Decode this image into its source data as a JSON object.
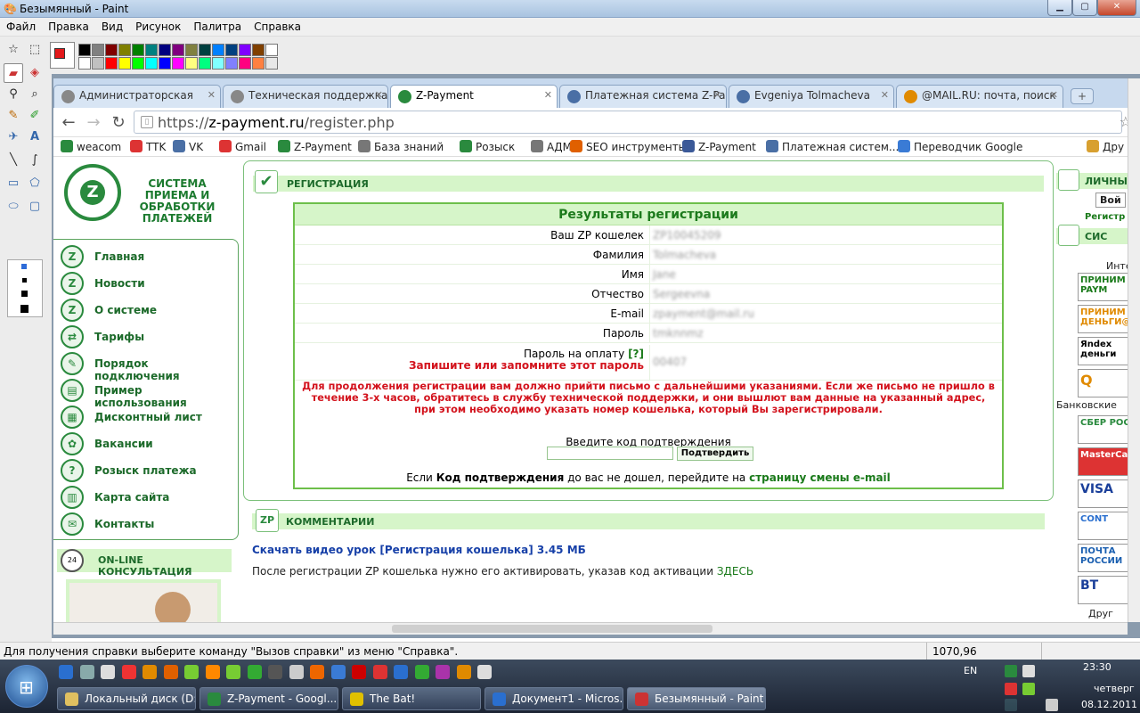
{
  "paint": {
    "title": "Безымянный - Paint",
    "menu": [
      "Файл",
      "Правка",
      "Вид",
      "Рисунок",
      "Палитра",
      "Справка"
    ],
    "status_text": "Для получения справки выберите команду \"Вызов справки\" из меню \"Справка\".",
    "coords": "1070,96",
    "palette_top": [
      "#000000",
      "#808080",
      "#800000",
      "#808000",
      "#008000",
      "#008080",
      "#000080",
      "#800080",
      "#808040",
      "#004040",
      "#0080ff",
      "#004080",
      "#8000ff",
      "#804000",
      "#ffffff"
    ],
    "palette_bottom": [
      "#ffffff",
      "#c0c0c0",
      "#ff0000",
      "#ffff00",
      "#00ff00",
      "#00ffff",
      "#0000ff",
      "#ff00ff",
      "#ffff80",
      "#00ff80",
      "#80ffff",
      "#8080ff",
      "#ff0080",
      "#ff8040",
      "#e8e8e8"
    ]
  },
  "browser": {
    "tabs": [
      {
        "label": "Администраторская",
        "icon_color": "#888888"
      },
      {
        "label": "Техническая поддержка",
        "icon_color": "#888888"
      },
      {
        "label": "Z-Payment",
        "icon_color": "#2a8a3e"
      },
      {
        "label": "Платежная система Z-Pay",
        "icon_color": "#4a6fa5"
      },
      {
        "label": "Evgeniya Tolmacheva",
        "icon_color": "#4a6fa5"
      },
      {
        "label": "@MAIL.RU: почта, поиск",
        "icon_color": "#e08a00"
      }
    ],
    "url_prefix": "https://",
    "url_domain": "z-payment.ru",
    "url_path": "/register.php",
    "bookmarks": [
      {
        "label": "weacom",
        "color": "#2a8a3e"
      },
      {
        "label": "TTK",
        "color": "#d33"
      },
      {
        "label": "VK",
        "color": "#4a6fa5"
      },
      {
        "label": "Gmail",
        "color": "#d33"
      },
      {
        "label": "Z-Payment",
        "color": "#2a8a3e"
      },
      {
        "label": "База знаний",
        "color": "#777"
      },
      {
        "label": "Розыск",
        "color": "#2a8a3e"
      },
      {
        "label": "АДМ",
        "color": "#777"
      },
      {
        "label": "SEO инструменты",
        "color": "#e06000"
      },
      {
        "label": "Z-Payment",
        "color": "#3b5998"
      },
      {
        "label": "Платежная систем...",
        "color": "#4a6fa5"
      },
      {
        "label": "Переводчик Google",
        "color": "#3a7bd5"
      },
      {
        "label": "Дру",
        "color": "#d8a030"
      }
    ]
  },
  "site": {
    "logo_text": "СИСТЕМА ПРИЕМА И ОБРАБОТКИ ПЛАТЕЖЕЙ",
    "nav": [
      "Главная",
      "Новости",
      "О системе",
      "Тарифы",
      "Порядок подключения",
      "Пример использования",
      "Дисконтный лист",
      "Вакансии",
      "Розыск платежа",
      "Карта сайта",
      "Контакты"
    ],
    "consult": "ON-LINE КОНСУЛЬТАЦИЯ",
    "section_title": "РЕГИСТРАЦИЯ",
    "results_title": "Результаты регистрации",
    "rows": [
      {
        "label": "Ваш ZP кошелек",
        "value": "ZP10045209"
      },
      {
        "label": "Фамилия",
        "value": "Tolmacheva"
      },
      {
        "label": "Имя",
        "value": "Jane"
      },
      {
        "label": "Отчество",
        "value": "Sergeevna"
      },
      {
        "label": "E-mail",
        "value": "zpayment@mail.ru"
      },
      {
        "label": "Пароль",
        "value": "tmknnmz"
      }
    ],
    "pay_password_label": "Пароль на оплату",
    "pay_password_help": "[?]",
    "pay_password_note": "Запишите или запомните этот пароль",
    "pay_password_value": "00407",
    "warning": "Для продолжения регистрации вам должно прийти письмо с дальнейшими указаниями. Если же письмо не пришло в течение 3-х часов, обратитесь в службу технической поддержки, и они вышлют вам данные на указанный адрес, при этом необходимо указать номер кошелька, который Вы зарегистрировали.",
    "confirm_label": "Введите код подтверждения",
    "confirm_button": "Подтвердить",
    "resend_prefix": "Если",
    "resend_bold": "Код подтверждения",
    "resend_mid": "до вас не дошел, перейдите на",
    "resend_link": "страницу смены e-mail",
    "comments_title": "КОММЕНТАРИИ",
    "download": "Скачать видео урок [Регистрация кошелька] 3.45 МБ",
    "after_text": "После регистрации ZP кошелька нужно его активировать, указав код активации",
    "after_link": "ЗДЕСЬ",
    "right": {
      "head1": "ЛИЧНЫ",
      "btn": "Вой",
      "reg": "Регистр",
      "head2": "СИС",
      "inter": "Интер",
      "logos": [
        "ПРИНИМ Z-PAYM",
        "ПРИНИМ ДЕНЬГИ@",
        "Яndex деньги",
        "Q"
      ],
      "banks_label": "Банковские",
      "banks": [
        "СБЕР РОС",
        "MasterCard",
        "VISA",
        "CONT",
        "ПОЧТА РОССИИ",
        "ВТ"
      ],
      "other": "Друг"
    }
  },
  "taskbar": {
    "tasks": [
      "Локальный диск (D:)",
      "Z-Payment - Googl...",
      "The Bat!",
      "Документ1 - Micros...",
      "Безымянный - Paint"
    ],
    "lang": "EN",
    "time": "23:30",
    "day": "четверг",
    "date": "08.12.2011"
  }
}
